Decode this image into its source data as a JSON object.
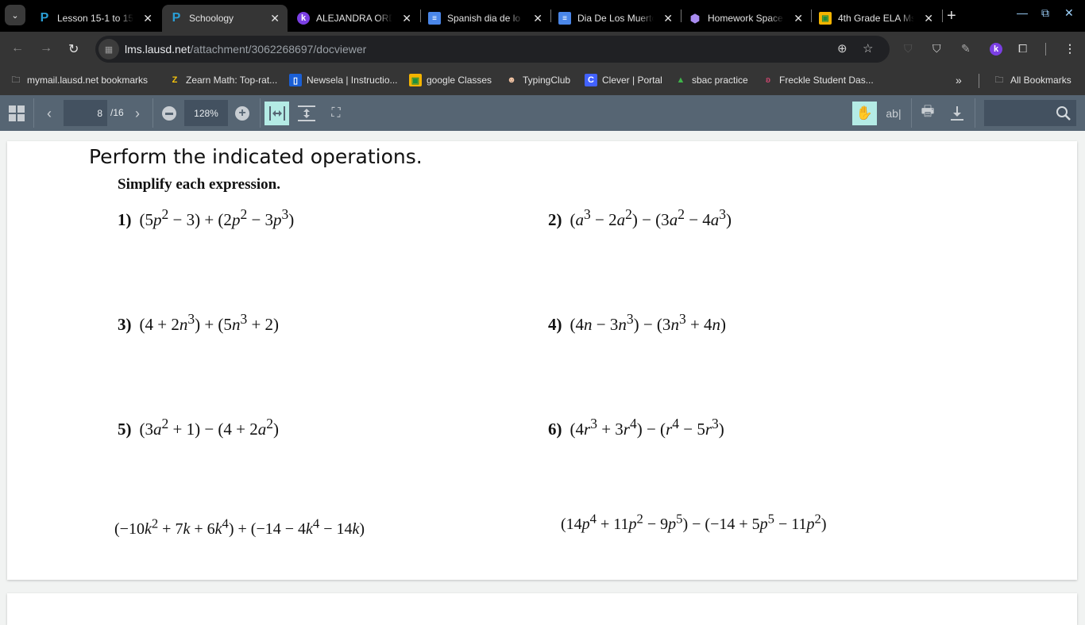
{
  "browser": {
    "tabs": [
      {
        "title": "Lesson 15-1 to 15",
        "icon": "schoology-icon",
        "active": false
      },
      {
        "title": "Schoology",
        "icon": "schoology-icon",
        "active": true
      },
      {
        "title": "ALEJANDRA ORD",
        "icon": "kami-icon",
        "active": false
      },
      {
        "title": "Spanish dia de lo",
        "icon": "google-docs-icon",
        "active": false
      },
      {
        "title": "Dia De Los Muerto",
        "icon": "google-docs-icon",
        "active": false
      },
      {
        "title": "Homework Space",
        "icon": "gem-icon",
        "active": false
      },
      {
        "title": "4th Grade ELA Ms",
        "icon": "google-classroom-icon",
        "active": false
      }
    ],
    "url": {
      "host": "lms.lausd.net",
      "path": "/attachment/3062268697/docviewer"
    },
    "bookmarks": [
      {
        "label": "mymail.lausd.net bookmarks",
        "icon": "folder-icon"
      },
      {
        "label": "Zearn Math: Top-rat...",
        "icon": "zearn-icon"
      },
      {
        "label": "Newsela | Instructio...",
        "icon": "newsela-icon"
      },
      {
        "label": "google Classes",
        "icon": "google-classroom-icon"
      },
      {
        "label": "TypingClub",
        "icon": "typingclub-icon"
      },
      {
        "label": "Clever | Portal",
        "icon": "clever-icon"
      },
      {
        "label": "sbac practice",
        "icon": "sbac-icon"
      },
      {
        "label": "Freckle Student Das...",
        "icon": "freckle-icon"
      }
    ],
    "all_bookmarks_label": "All Bookmarks",
    "overflow_label": "»"
  },
  "viewer": {
    "current_page": "8",
    "total_pages": "/16",
    "zoom": "128%",
    "search_placeholder": ""
  },
  "document": {
    "heading": "Perform the indicated operations.",
    "subheading": "Simplify each expression.",
    "problems": [
      {
        "number": "1)",
        "html": "(5<i>p</i><sup>2</sup> − 3) + (2<i>p</i><sup>2</sup> − 3<i>p</i><sup>3</sup>)"
      },
      {
        "number": "2)",
        "html": "(<i>a</i><sup>3</sup> − 2<i>a</i><sup>2</sup>) − (3<i>a</i><sup>2</sup> − 4<i>a</i><sup>3</sup>)"
      },
      {
        "number": "3)",
        "html": "(4 + 2<i>n</i><sup>3</sup>) + (5<i>n</i><sup>3</sup> + 2)"
      },
      {
        "number": "4)",
        "html": "(4<i>n</i> − 3<i>n</i><sup>3</sup>) − (3<i>n</i><sup>3</sup> + 4<i>n</i>)"
      },
      {
        "number": "5)",
        "html": "(3<i>a</i><sup>2</sup> + 1) − (4 + 2<i>a</i><sup>2</sup>)"
      },
      {
        "number": "6)",
        "html": "(4<i>r</i><sup>3</sup> + 3<i>r</i><sup>4</sup>) − (<i>r</i><sup>4</sup> − 5<i>r</i><sup>3</sup>)"
      },
      {
        "number": "",
        "html": "(−10<i>k</i><sup>2</sup> + 7<i>k</i> + 6<i>k</i><sup>4</sup>) + (−14 − 4<i>k</i><sup>4</sup> − 14<i>k</i>)"
      },
      {
        "number": "",
        "html": "(14<i>p</i><sup>4</sup> + 11<i>p</i><sup>2</sup> − 9<i>p</i><sup>5</sup>) − (−14 + 5<i>p</i><sup>5</sup> − 11<i>p</i><sup>2</sup>)"
      }
    ]
  }
}
